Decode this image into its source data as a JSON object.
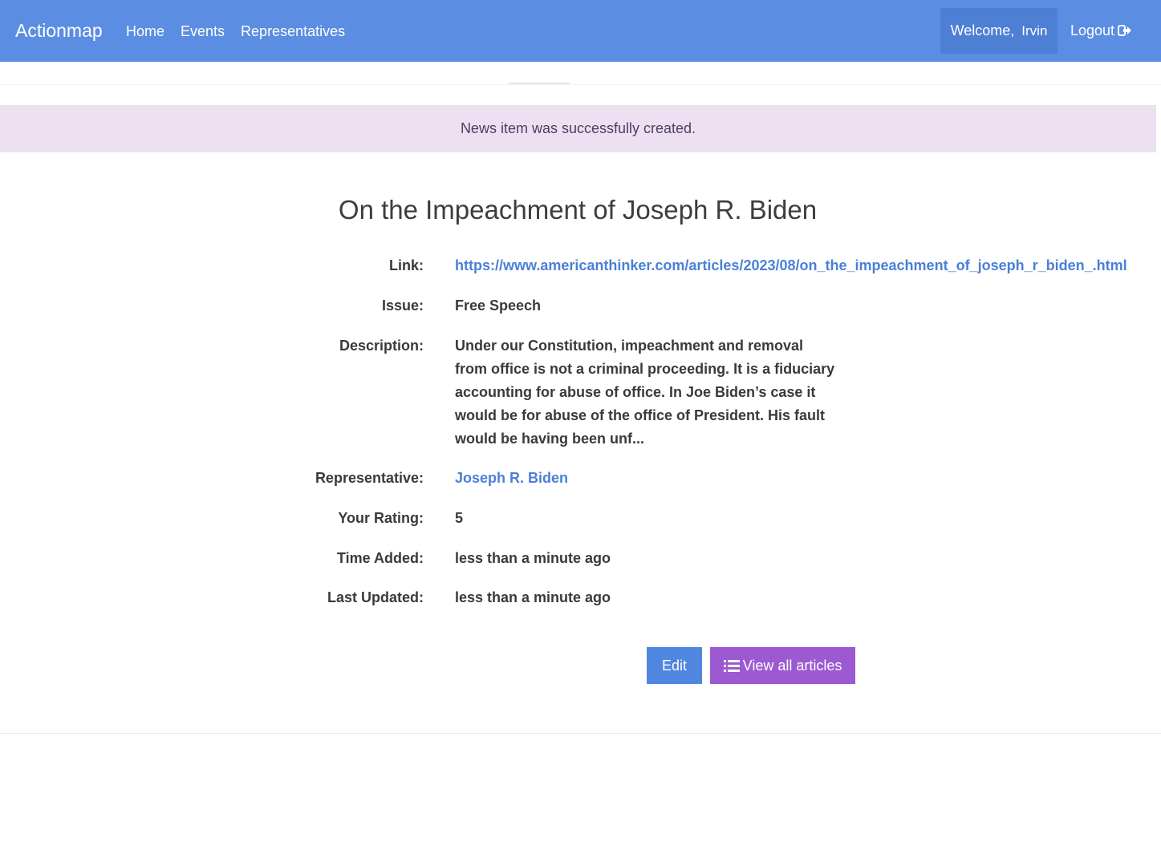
{
  "navbar": {
    "brand": "Actionmap",
    "links": [
      "Home",
      "Events",
      "Representatives"
    ],
    "welcome_label": "Welcome,",
    "username": "Irvin",
    "logout_label": "Logout",
    "colors": {
      "navbar": "#5b8ee3",
      "welcome_bg": "#4d7fd4"
    }
  },
  "alert": {
    "message": "News item was successfully created.",
    "color": "#ede0f1"
  },
  "article": {
    "title": "On the Impeachment of Joseph R. Biden",
    "fields": {
      "link_label": "Link:",
      "link_value": "https://www.americanthinker.com/articles/2023/08/on_the_impeachment_of_joseph_r_biden_.html",
      "issue_label": "Issue:",
      "issue_value": "Free Speech",
      "description_label": "Description:",
      "description_value": "Under our Constitution, impeachment and removal from office is not a criminal proceeding. It is a fiduciary accounting for abuse of office. In Joe Biden’s case it would be for abuse of the office of President. His fault would be having been unf...",
      "representative_label": "Representative:",
      "representative_value": "Joseph R. Biden",
      "rating_label": "Your Rating:",
      "rating_value": "5",
      "time_added_label": "Time Added:",
      "time_added_value": "less than a minute ago",
      "last_updated_label": "Last Updated:",
      "last_updated_value": "less than a minute ago"
    }
  },
  "actions": {
    "edit_label": "Edit",
    "view_all_label": "View all articles",
    "view_all_icon": "list-icon",
    "colors": {
      "edit": "#4f86e0",
      "view_all": "#9c59d1"
    }
  }
}
